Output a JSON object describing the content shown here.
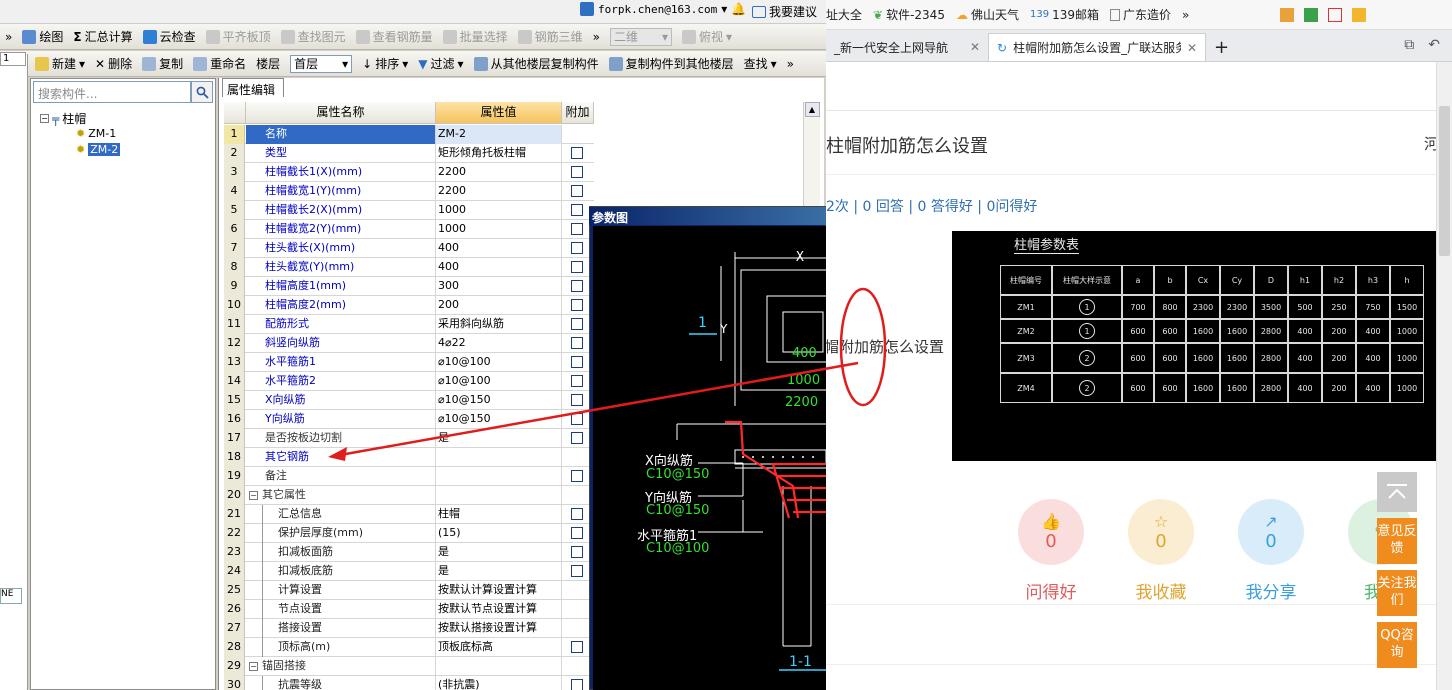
{
  "app": {
    "toolbar1": {
      "draw": "绘图",
      "summary": "汇总计算",
      "cloud_check": "云检查",
      "flatten": "平齐板顶",
      "find_element": "查找图元",
      "view_rebar": "查看钢筋量",
      "batch_select": "批量选择",
      "rebar_3d": "钢筋三维",
      "more": "»",
      "view_2d": "二维",
      "view_top": "俯视"
    },
    "toolbar2": {
      "new": "新建",
      "delete": "删除",
      "copy": "复制",
      "rename": "重命名",
      "floor_label": "楼层",
      "floor_value": "首层",
      "sort": "排序",
      "filter": "过滤",
      "copy_from_floor": "从其他楼层复制构件",
      "copy_to_floor": "复制构件到其他楼层",
      "find": "查找",
      "more": "»"
    },
    "left_value": "1",
    "left_badge": "NE",
    "search_placeholder": "搜索构件...",
    "tree": {
      "root": "柱帽",
      "children": [
        "ZM-1",
        "ZM-2"
      ]
    },
    "prop_tab": "属性编辑",
    "grid_headers": {
      "name": "属性名称",
      "value": "属性值",
      "extra": "附加"
    },
    "rows": [
      {
        "no": "1",
        "name": "名称",
        "value": "ZM-2",
        "style": "blue",
        "chk": false
      },
      {
        "no": "2",
        "name": "类型",
        "value": "矩形倾角托板柱帽",
        "style": "blue",
        "chk": true
      },
      {
        "no": "3",
        "name": "柱帽截长1(X)(mm)",
        "value": "2200",
        "style": "blue",
        "chk": true
      },
      {
        "no": "4",
        "name": "柱帽截宽1(Y)(mm)",
        "value": "2200",
        "style": "blue",
        "chk": true
      },
      {
        "no": "5",
        "name": "柱帽截长2(X)(mm)",
        "value": "1000",
        "style": "blue",
        "chk": true
      },
      {
        "no": "6",
        "name": "柱帽截宽2(Y)(mm)",
        "value": "1000",
        "style": "blue",
        "chk": true
      },
      {
        "no": "7",
        "name": "柱头截长(X)(mm)",
        "value": "400",
        "style": "blue",
        "chk": true
      },
      {
        "no": "8",
        "name": "柱头截宽(Y)(mm)",
        "value": "400",
        "style": "blue",
        "chk": true
      },
      {
        "no": "9",
        "name": "柱帽高度1(mm)",
        "value": "300",
        "style": "blue",
        "chk": true
      },
      {
        "no": "10",
        "name": "柱帽高度2(mm)",
        "value": "200",
        "style": "blue",
        "chk": true
      },
      {
        "no": "11",
        "name": "配筋形式",
        "value": "采用斜向纵筋",
        "style": "blue",
        "chk": true
      },
      {
        "no": "12",
        "name": "斜竖向纵筋",
        "value": "4⌀22",
        "style": "blue",
        "chk": true
      },
      {
        "no": "13",
        "name": "水平箍筋1",
        "value": "⌀10@100",
        "style": "blue",
        "chk": true
      },
      {
        "no": "14",
        "name": "水平箍筋2",
        "value": "⌀10@100",
        "style": "blue",
        "chk": true
      },
      {
        "no": "15",
        "name": "X向纵筋",
        "value": "⌀10@150",
        "style": "blue",
        "chk": true
      },
      {
        "no": "16",
        "name": "Y向纵筋",
        "value": "⌀10@150",
        "style": "blue",
        "chk": true
      },
      {
        "no": "17",
        "name": "是否按板边切割",
        "value": "是",
        "style": "gray",
        "chk": true
      },
      {
        "no": "18",
        "name": "其它钢筋",
        "value": "",
        "style": "blue",
        "chk": false
      },
      {
        "no": "19",
        "name": "备注",
        "value": "",
        "style": "gray",
        "chk": true
      },
      {
        "no": "20",
        "name": "其它属性",
        "value": "",
        "style": "group",
        "chk": false
      },
      {
        "no": "21",
        "name": "汇总信息",
        "value": "柱帽",
        "style": "child",
        "chk": true
      },
      {
        "no": "22",
        "name": "保护层厚度(mm)",
        "value": "(15)",
        "style": "child",
        "chk": true
      },
      {
        "no": "23",
        "name": "扣减板面筋",
        "value": "是",
        "style": "child",
        "chk": true
      },
      {
        "no": "24",
        "name": "扣减板底筋",
        "value": "是",
        "style": "child",
        "chk": true
      },
      {
        "no": "25",
        "name": "计算设置",
        "value": "按默认计算设置计算",
        "style": "child",
        "chk": false
      },
      {
        "no": "26",
        "name": "节点设置",
        "value": "按默认节点设置计算",
        "style": "child",
        "chk": false
      },
      {
        "no": "27",
        "name": "搭接设置",
        "value": "按默认搭接设置计算",
        "style": "child",
        "chk": false
      },
      {
        "no": "28",
        "name": "顶标高(m)",
        "value": "顶板底标高",
        "style": "child",
        "chk": true
      },
      {
        "no": "29",
        "name": "锚固搭接",
        "value": "",
        "style": "group",
        "chk": false
      },
      {
        "no": "30",
        "name": "抗震等级",
        "value": "(非抗震)",
        "style": "child",
        "chk": true
      }
    ],
    "drawing": {
      "title": "参数图",
      "dim_x": "X",
      "dim_y": "Y",
      "section_mark": "1",
      "dim_400": "400",
      "dim_1000": "1000",
      "dim_2200": "2200",
      "x_rebar": "X向纵筋",
      "x_rebar_val": "C10@150",
      "y_rebar": "Y向纵筋",
      "y_rebar_val": "C10@150",
      "h_stirrup": "水平箍筋1",
      "h_stirrup_val": "C10@100",
      "section_label": "1-1"
    }
  },
  "browser": {
    "account": "forpk.chen@163.com",
    "feedback_top": "我要建议",
    "favs": [
      "址大全",
      "软件-2345",
      "佛山天气",
      "139邮箱",
      "广东造价"
    ],
    "fav_more": "»",
    "tabs": [
      {
        "label": "_新一代安全上网导航"
      },
      {
        "label": "柱帽附加筋怎么设置_广联达服务"
      }
    ],
    "new_tab": "+",
    "question_title": "柱帽附加筋怎么设置",
    "right_char": "河",
    "stats": "2次 | 0 回答 | 0 答得好 | 0问得好",
    "inline_text": "帽附加筋怎么设置",
    "table_image": {
      "title": "柱帽参数表",
      "headers": [
        "柱帽编号",
        "柱帽大样示意",
        "a",
        "b",
        "Cx",
        "Cy",
        "D",
        "h1",
        "h2",
        "h3",
        "h"
      ],
      "rows": [
        [
          "ZM1",
          "1",
          "700",
          "800",
          "2300",
          "2300",
          "3500",
          "500",
          "250",
          "750",
          "1500"
        ],
        [
          "ZM2",
          "1",
          "600",
          "600",
          "1600",
          "1600",
          "2800",
          "400",
          "200",
          "400",
          "1000"
        ],
        [
          "ZM3",
          "2",
          "600",
          "600",
          "1600",
          "1600",
          "2800",
          "400",
          "200",
          "400",
          "1000"
        ],
        [
          "ZM4",
          "2",
          "600",
          "600",
          "1600",
          "1600",
          "2800",
          "400",
          "200",
          "400",
          "1000"
        ]
      ]
    },
    "actions": [
      {
        "count": "0",
        "label": "问得好",
        "color": "#e25b5b"
      },
      {
        "count": "0",
        "label": "我收藏",
        "color": "#e0a431"
      },
      {
        "count": "0",
        "label": "我分享",
        "color": "#3b9fde"
      },
      {
        "count": "",
        "label": "我答",
        "color": "#4cb86b"
      }
    ],
    "side_buttons": [
      "意见反馈",
      "关注我们",
      "QQ咨询"
    ]
  }
}
